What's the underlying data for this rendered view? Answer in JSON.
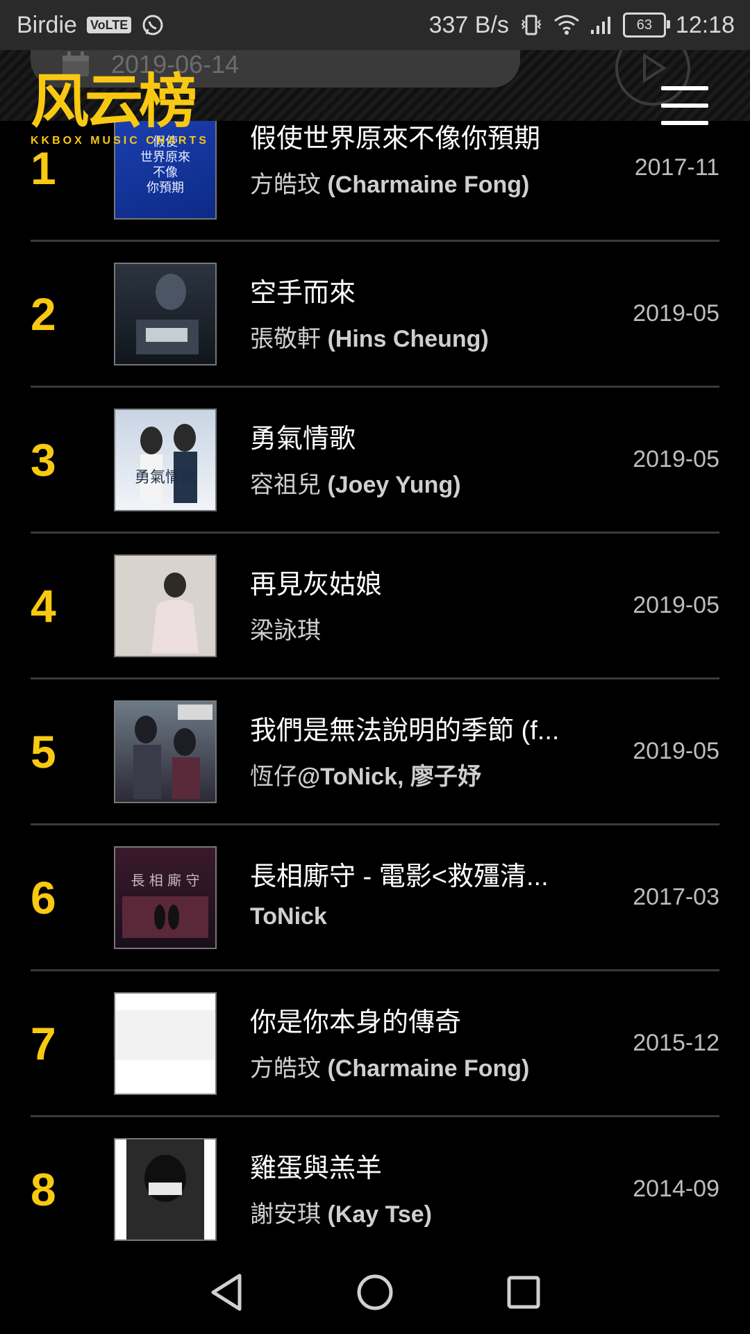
{
  "status_bar": {
    "carrier": "Birdie",
    "volte": "VoLTE",
    "net_speed": "337 B/s",
    "battery": "63",
    "time": "12:18",
    "icons": [
      "whatsapp-icon",
      "vibrate-icon",
      "wifi-icon",
      "signal-icon",
      "battery-icon"
    ]
  },
  "header": {
    "date": "2019-06-14",
    "logo_text": "风云榜",
    "logo_sub": "KKBOX MUSIC CHARTS"
  },
  "colors": {
    "accent": "#f9c912",
    "background": "#000000",
    "divider": "#3a3a3a"
  },
  "chart": {
    "items": [
      {
        "rank": "1",
        "title": "假使世界原來不像你預期",
        "artist_cn": "方皓玟",
        "artist_en": "(Charmaine Fong)",
        "date": "2017-11"
      },
      {
        "rank": "2",
        "title": "空手而來",
        "artist_cn": "張敬軒",
        "artist_en": "(Hins Cheung)",
        "date": "2019-05"
      },
      {
        "rank": "3",
        "title": "勇氣情歌",
        "artist_cn": "容祖兒",
        "artist_en": "(Joey Yung)",
        "date": "2019-05"
      },
      {
        "rank": "4",
        "title": "再見灰姑娘",
        "artist_cn": "梁詠琪",
        "artist_en": "",
        "date": "2019-05"
      },
      {
        "rank": "5",
        "title": "我們是無法說明的季節 (f...",
        "artist_cn": "恆仔",
        "artist_en": "@ToNick, 廖子妤",
        "date": "2019-05"
      },
      {
        "rank": "6",
        "title": "長相廝守 - 電影<救殭清...",
        "artist_cn": "",
        "artist_en": "ToNick",
        "date": "2017-03"
      },
      {
        "rank": "7",
        "title": "你是你本身的傳奇",
        "artist_cn": "方皓玟",
        "artist_en": "(Charmaine Fong)",
        "date": "2015-12"
      },
      {
        "rank": "8",
        "title": "雞蛋與羔羊",
        "artist_cn": "謝安琪",
        "artist_en": "(Kay Tse)",
        "date": "2014-09"
      }
    ]
  },
  "navbar": {
    "icons": [
      "back-icon",
      "home-icon",
      "recents-icon"
    ]
  }
}
